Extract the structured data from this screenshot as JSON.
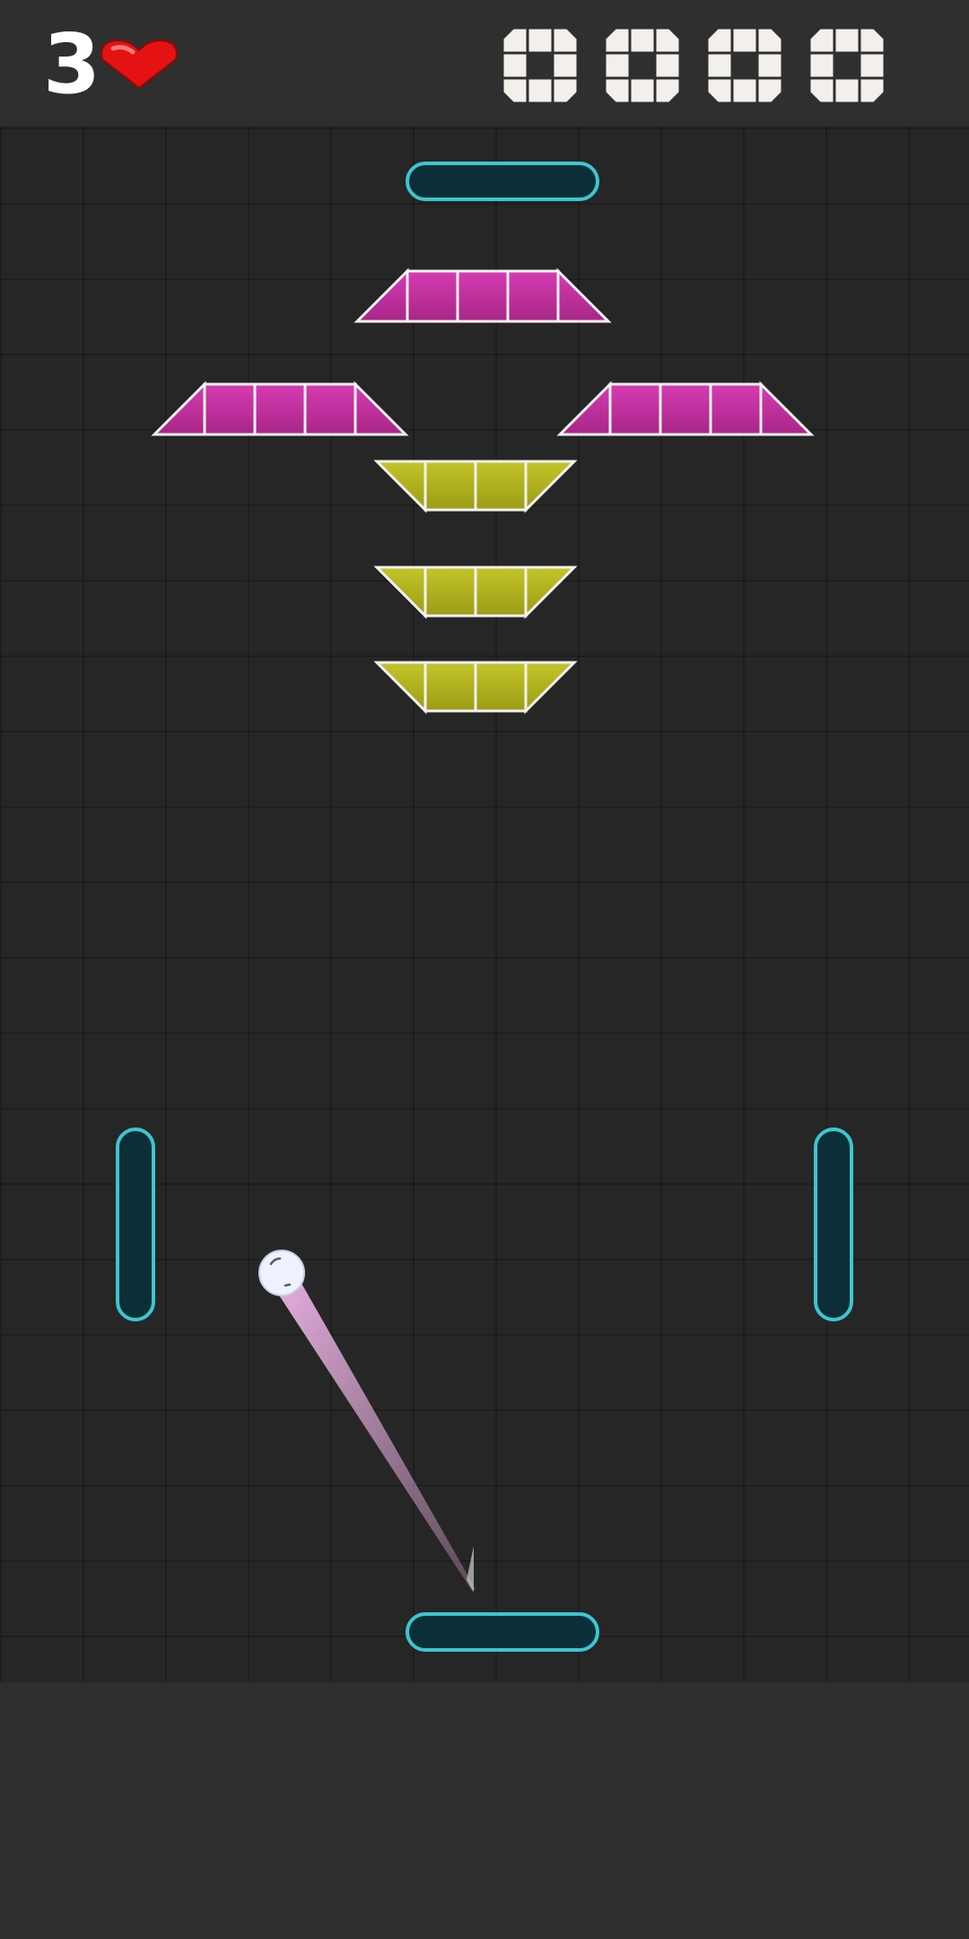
{
  "hud": {
    "lives": "3",
    "lives_icon": "heart-icon",
    "score_digits": [
      "0",
      "0",
      "0",
      "0"
    ]
  },
  "colors": {
    "background": "#2e2e2e",
    "grid_dark": "#262626",
    "paddle_fill": "#0b2e38",
    "paddle_stroke": "#3cc6d0",
    "brick_magenta": "#c0329e",
    "brick_yellow": "#b2b21e",
    "brick_border": "#f2f2f2",
    "ball": "#eef2ff",
    "trail": "#f0a8e8",
    "heart": "#e41212"
  },
  "paddles": [
    "top",
    "bottom",
    "left",
    "right"
  ],
  "brick_rows": [
    {
      "color": "magenta",
      "shape": "wide-top",
      "cells": 3
    },
    {
      "color": "magenta",
      "shape": "wide-top",
      "cells": 3
    },
    {
      "color": "magenta",
      "shape": "wide-top",
      "cells": 3
    },
    {
      "color": "yellow",
      "shape": "wide-bottom",
      "cells": 2
    },
    {
      "color": "yellow",
      "shape": "wide-bottom",
      "cells": 2
    },
    {
      "color": "yellow",
      "shape": "wide-bottom",
      "cells": 2
    }
  ]
}
